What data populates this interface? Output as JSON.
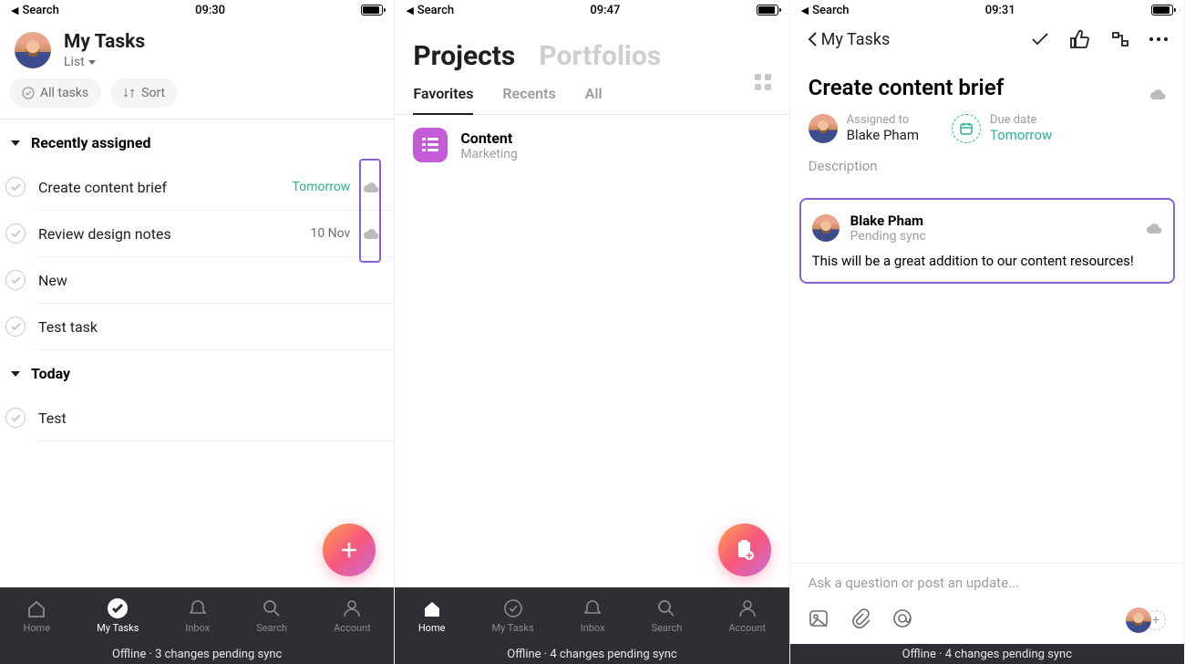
{
  "statusBar": {
    "back": "Search"
  },
  "screen1": {
    "time": "09:30",
    "title": "My Tasks",
    "view": "List",
    "filters": {
      "all": "All tasks",
      "sort": "Sort"
    },
    "sections": {
      "recently": "Recently assigned",
      "today": "Today"
    },
    "tasks": [
      {
        "name": "Create content brief",
        "due": "Tomorrow",
        "dueGreen": true,
        "cloud": true
      },
      {
        "name": "Review design notes",
        "due": "10 Nov",
        "cloud": true
      },
      {
        "name": "New"
      },
      {
        "name": "Test task"
      }
    ],
    "todayTasks": [
      {
        "name": "Test"
      }
    ],
    "offline": "Offline · 3 changes pending sync"
  },
  "screen2": {
    "time": "09:47",
    "mainTabs": {
      "projects": "Projects",
      "portfolios": "Portfolios"
    },
    "subTabs": {
      "favorites": "Favorites",
      "recents": "Recents",
      "all": "All"
    },
    "project": {
      "name": "Content",
      "team": "Marketing"
    },
    "offline": "Offline · 4 changes pending sync"
  },
  "screen3": {
    "time": "09:31",
    "back": "My Tasks",
    "title": "Create content brief",
    "assignedLabel": "Assigned to",
    "assignee": "Blake Pham",
    "dueLabel": "Due date",
    "due": "Tomorrow",
    "descLabel": "Description",
    "comment": {
      "author": "Blake Pham",
      "status": "Pending sync",
      "body": "This will be a great addition to our content resources!"
    },
    "composePlaceholder": "Ask a question or post an update...",
    "offline": "Offline · 4 changes pending sync"
  },
  "tabs": {
    "home": "Home",
    "mytasks": "My Tasks",
    "inbox": "Inbox",
    "search": "Search",
    "account": "Account"
  }
}
